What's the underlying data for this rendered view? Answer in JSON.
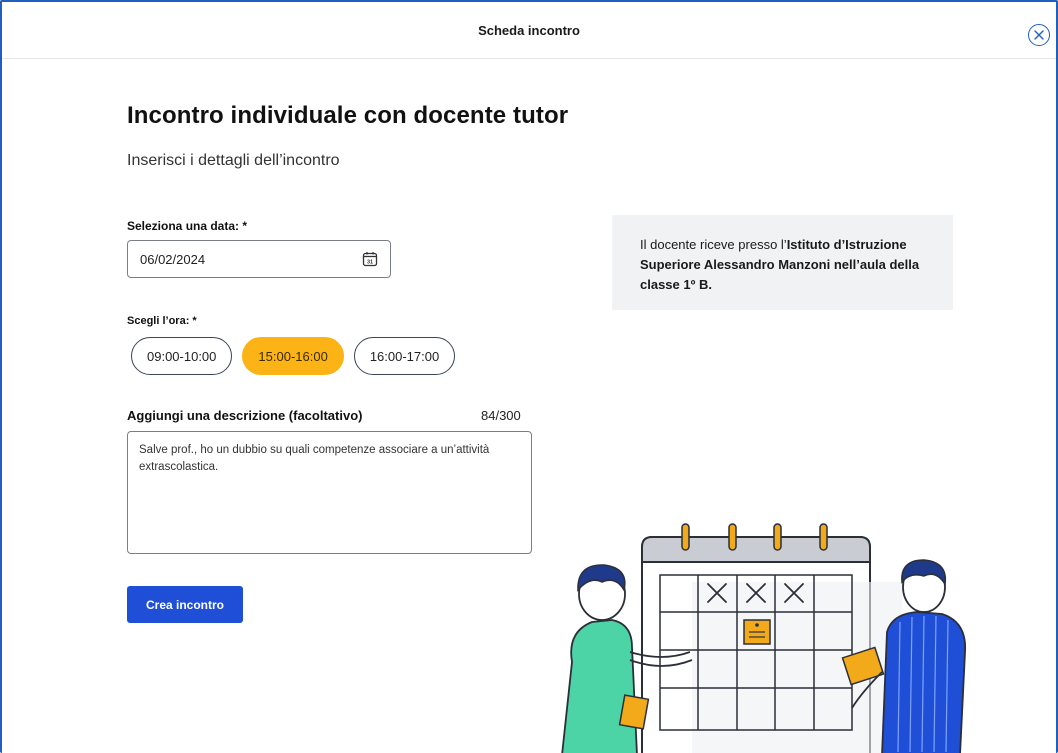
{
  "window": {
    "title": "Scheda incontro",
    "close_icon": "close-circle-icon"
  },
  "form": {
    "heading": "Incontro individuale con docente tutor",
    "subheading": "Inserisci i dettagli dell’incontro",
    "date": {
      "label": "Seleziona una data: *",
      "value": "06/02/2024",
      "icon": "calendar-icon"
    },
    "time": {
      "label": "Scegli l’ora: *",
      "options": [
        "09:00-10:00",
        "15:00-16:00",
        "16:00-17:00"
      ],
      "selected": "15:00-16:00"
    },
    "description": {
      "label": "Aggiungi una descrizione (facoltativo)",
      "counter": "84/300",
      "value": "Salve prof., ho un dubbio su quali competenze associare a un’attività extrascolastica."
    },
    "submit_label": "Crea incontro"
  },
  "info": {
    "prefix": "Il docente riceve presso l’",
    "bold": "Istituto d’Istruzione Superiore Alessandro Manzoni nell’aula della classe 1º B."
  },
  "colors": {
    "accent": "#1e4fd6",
    "selected_chip": "#fbb316",
    "info_bg": "#f1f2f4"
  }
}
